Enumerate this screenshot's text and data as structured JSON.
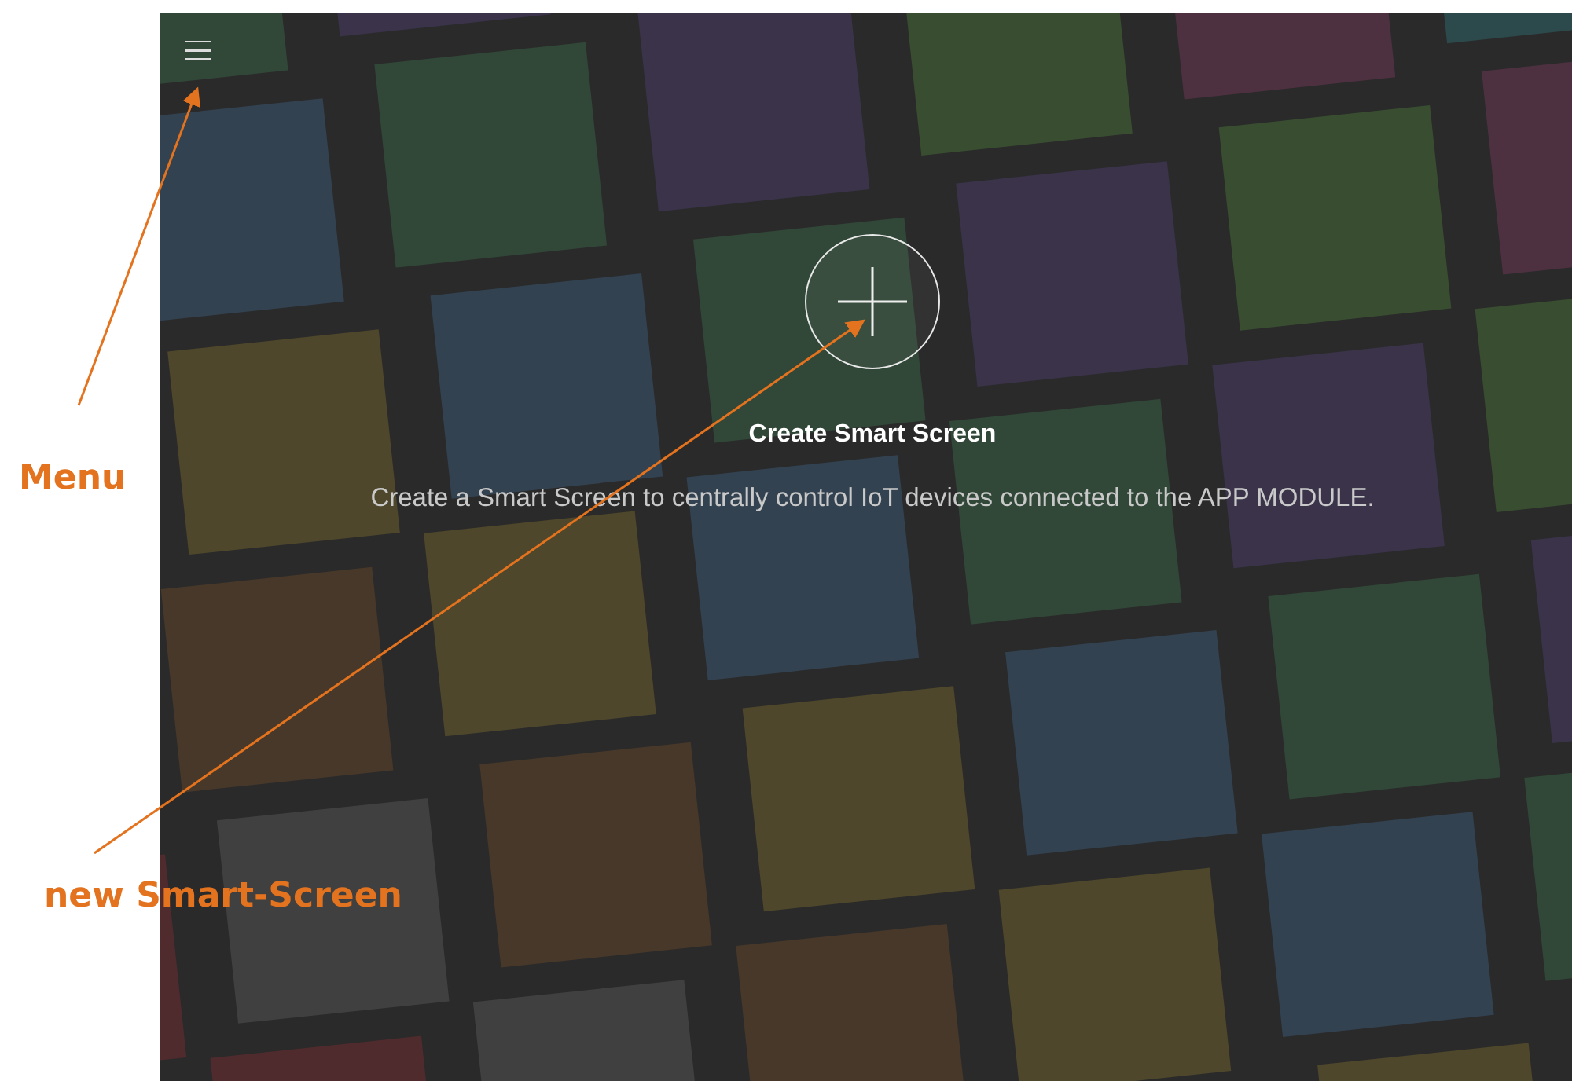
{
  "app": {
    "title": "Create Smart Screen",
    "description": "Create a Smart Screen to centrally control IoT devices connected to the APP MODULE."
  },
  "annotations": [
    {
      "label": "Menu"
    },
    {
      "label": "new Smart-Screen"
    }
  ]
}
